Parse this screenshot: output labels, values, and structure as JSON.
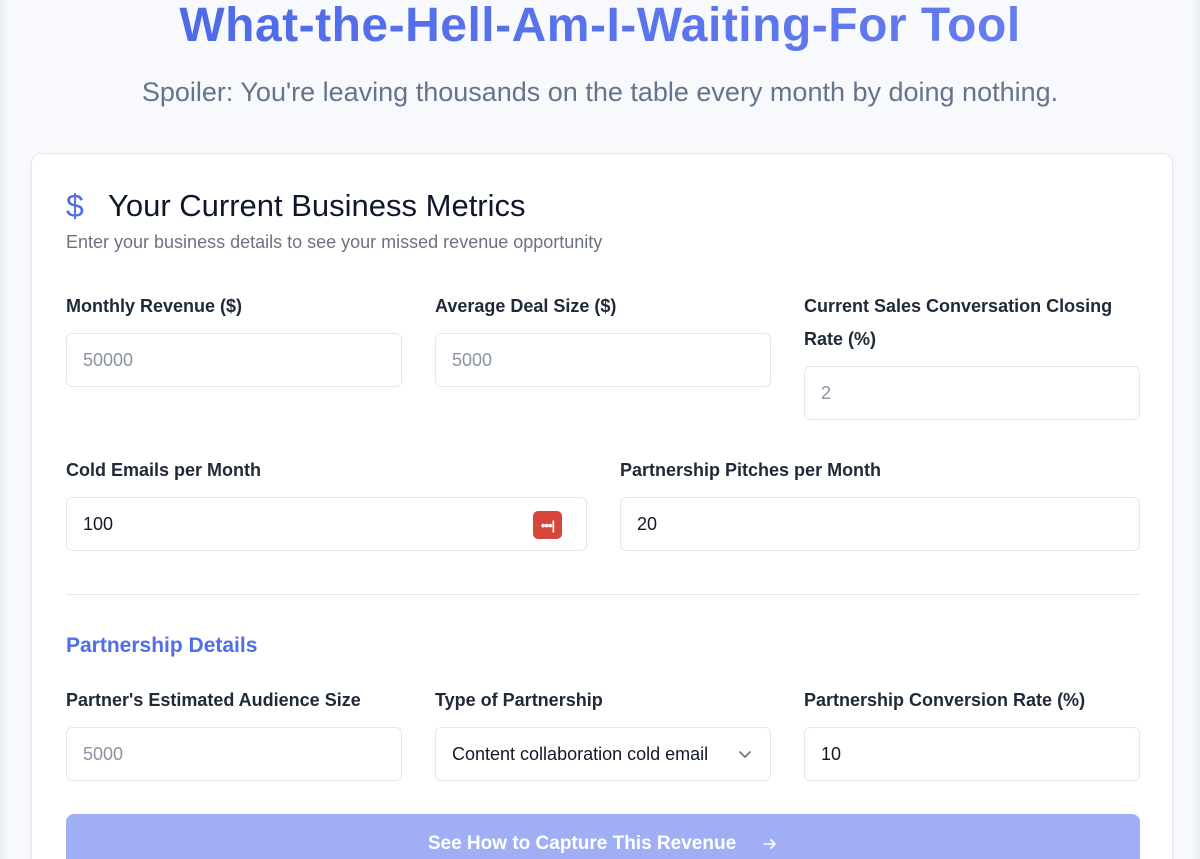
{
  "hero": {
    "title": "What-the-Hell-Am-I-Waiting-For Tool",
    "subtitle": "Spoiler: You're leaving thousands on the table every month by doing nothing."
  },
  "card": {
    "icon": "dollar-icon",
    "title": "Your Current Business Metrics",
    "description": "Enter your business details to see your missed revenue opportunity"
  },
  "fields": {
    "monthly_revenue": {
      "label": "Monthly Revenue ($)",
      "placeholder": "50000",
      "value": ""
    },
    "average_deal_size": {
      "label": "Average Deal Size ($)",
      "placeholder": "5000",
      "value": ""
    },
    "closing_rate": {
      "label_line1": "Current Sales Conversation Closing",
      "label_line2": "Rate (%)",
      "placeholder": "2",
      "value": ""
    },
    "cold_emails": {
      "label": "Cold Emails per Month",
      "value": "100",
      "badge_text": "•••|"
    },
    "partnership_pitches": {
      "label": "Partnership Pitches per Month",
      "value": "20"
    }
  },
  "partnership": {
    "heading": "Partnership Details",
    "audience_size": {
      "label": "Partner's Estimated Audience Size",
      "placeholder": "5000",
      "value": ""
    },
    "type": {
      "label": "Type of Partnership",
      "selected": "Content collaboration cold email"
    },
    "conversion_rate": {
      "label": "Partnership Conversion Rate (%)",
      "value": "10"
    }
  },
  "cta": {
    "label": "See How to Capture This Revenue"
  },
  "colors": {
    "accent": "#4f6ee8",
    "cta_background": "#a0aff5",
    "password_badge": "#d6463a"
  }
}
